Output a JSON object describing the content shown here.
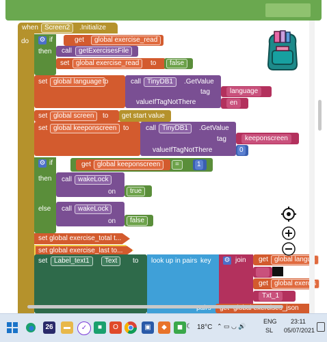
{
  "when_block": {
    "when": "when",
    "component": "Screen2",
    "event": ".Initialize",
    "do": "do"
  },
  "if1": {
    "if": "if",
    "get": "get",
    "var": "global exercise_read",
    "then": "then",
    "call": "call",
    "method": "getExercisesFile",
    "set": "set",
    "set_var": "global exercise_read",
    "to": "to",
    "value": "false"
  },
  "set_language": {
    "set": "set",
    "var": "global language",
    "to": "to",
    "call": "call",
    "component": "TinyDB1",
    "method": ".GetValue",
    "tag_label": "tag",
    "tag_value": "language",
    "vitn_label": "valueIfTagNotThere",
    "vitn_value": "en"
  },
  "set_screen": {
    "set": "set",
    "var": "global screen",
    "to": "to",
    "value": "get start value"
  },
  "set_keeponscreen": {
    "set": "set",
    "var": "global keeponscreen",
    "to": "to",
    "call": "call",
    "component": "TinyDB1",
    "method": ".GetValue",
    "tag_label": "tag",
    "tag_value": "keeponscreen",
    "vitn_label": "valueIfTagNotThere",
    "vitn_value": "0"
  },
  "if2": {
    "if": "if",
    "get": "get",
    "var": "global keeponscreen",
    "op": "=",
    "num": "1",
    "then": "then",
    "else": "else",
    "call": "call",
    "method": "wakeLock",
    "on": "on",
    "then_value": "true",
    "else_value": "false"
  },
  "collapsed": {
    "first": "set global exercise_total t...",
    "second": "set global exercise_last to..."
  },
  "set_label": {
    "set": "set",
    "component": "Label_text1",
    "prop": "Text",
    "to": "to",
    "lookup": "look up in pairs",
    "key": "key",
    "join": "join",
    "get": "get",
    "var1": "global langua",
    "var2": "global exercis",
    "txt": "Txt_1",
    "pairs": "pairs",
    "var3": "global exercises_json"
  },
  "taskbar": {
    "badge": "26",
    "temp": "18°C",
    "lang1": "ENG",
    "lang2": "SL",
    "time": "23:11",
    "date": "05/07/2021"
  },
  "icons": [
    "windows-icon",
    "search-icon",
    "edge-icon",
    "folder-icon",
    "vpn-icon",
    "store-icon",
    "office-icon",
    "chrome-icon",
    "photos-icon",
    "app-icon",
    "mail-icon",
    "green-app-icon"
  ]
}
